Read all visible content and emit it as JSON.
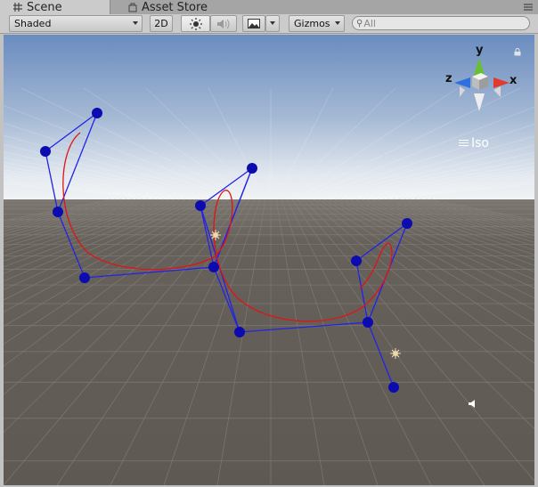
{
  "tabs": [
    {
      "label": "Scene",
      "icon": "grid-icon",
      "active": true
    },
    {
      "label": "Asset Store",
      "icon": "bag-icon",
      "active": false
    }
  ],
  "toolbar": {
    "draw_mode": "Shaded",
    "toggle_2d": "2D",
    "gizmos": "Gizmos",
    "search_placeholder": "All"
  },
  "gizmo": {
    "x_label": "x",
    "y_label": "y",
    "z_label": "z",
    "projection": "Iso"
  },
  "colors": {
    "sky_top": "#6d8fc2",
    "horizon": "#eef0f2",
    "ground": "#625c57",
    "handle": "#0b0bb0",
    "handle_line": "#2323e6",
    "curve": "#e01414",
    "x_axis": "#e23b2e",
    "y_axis": "#66c22c",
    "z_axis": "#2f6fe0"
  }
}
